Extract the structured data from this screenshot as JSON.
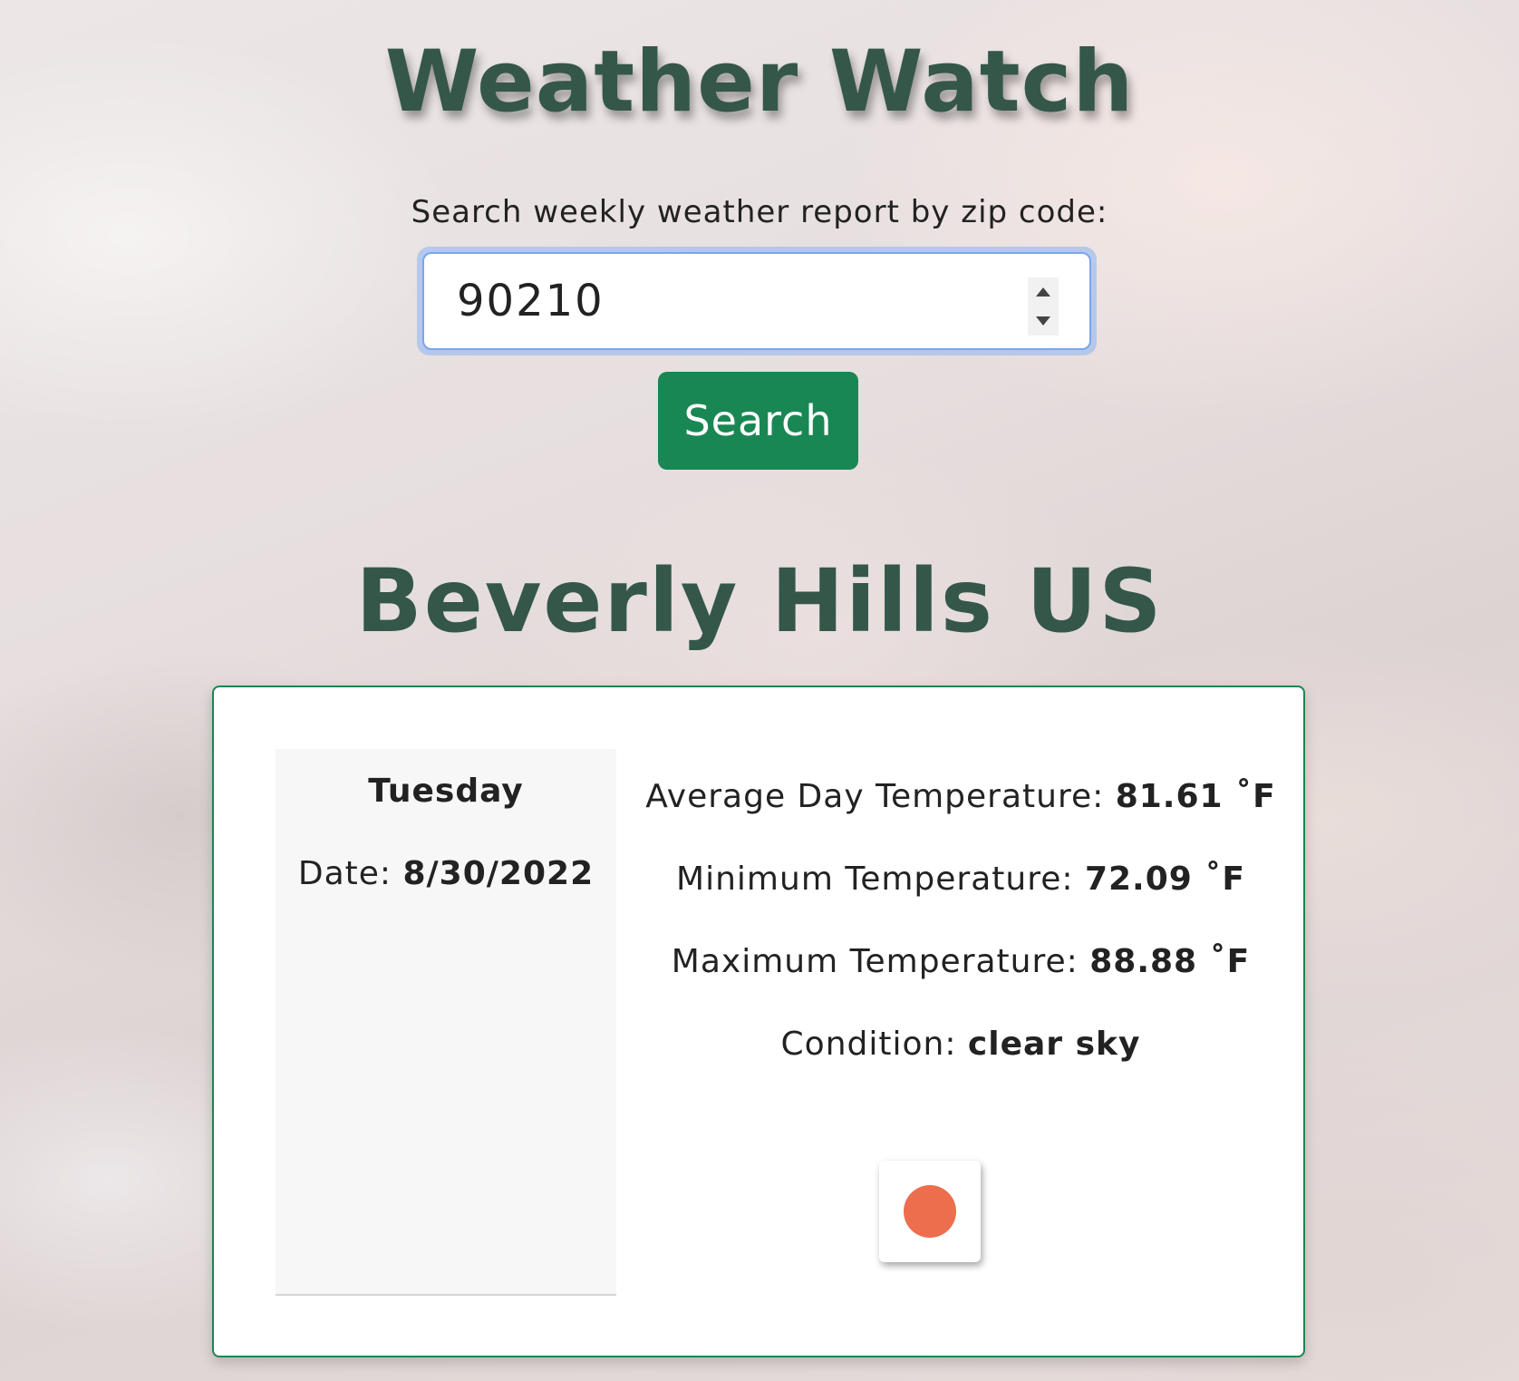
{
  "app": {
    "title": "Weather Watch"
  },
  "search": {
    "label": "Search weekly weather report by zip code:",
    "zip_value": "90210",
    "button_label": "Search"
  },
  "location": {
    "name": "Beverly Hills US"
  },
  "forecast": {
    "day": "Tuesday",
    "date_label": "Date: ",
    "date_value": "8/30/2022",
    "avg_temp_label": "Average Day Temperature: ",
    "avg_temp_value": "81.61 ˚F",
    "min_temp_label": "Minimum Temperature: ",
    "min_temp_value": "72.09 ˚F",
    "max_temp_label": "Maximum Temperature: ",
    "max_temp_value": "88.88 ˚F",
    "condition_label": "Condition: ",
    "condition_value": "clear sky",
    "icon": "clear-sky-sun-icon",
    "icon_color": "#ec6e4d"
  },
  "colors": {
    "title": "#34574a",
    "button": "#198754",
    "card_border": "#198754",
    "focus_ring": "#7aa6ee"
  }
}
